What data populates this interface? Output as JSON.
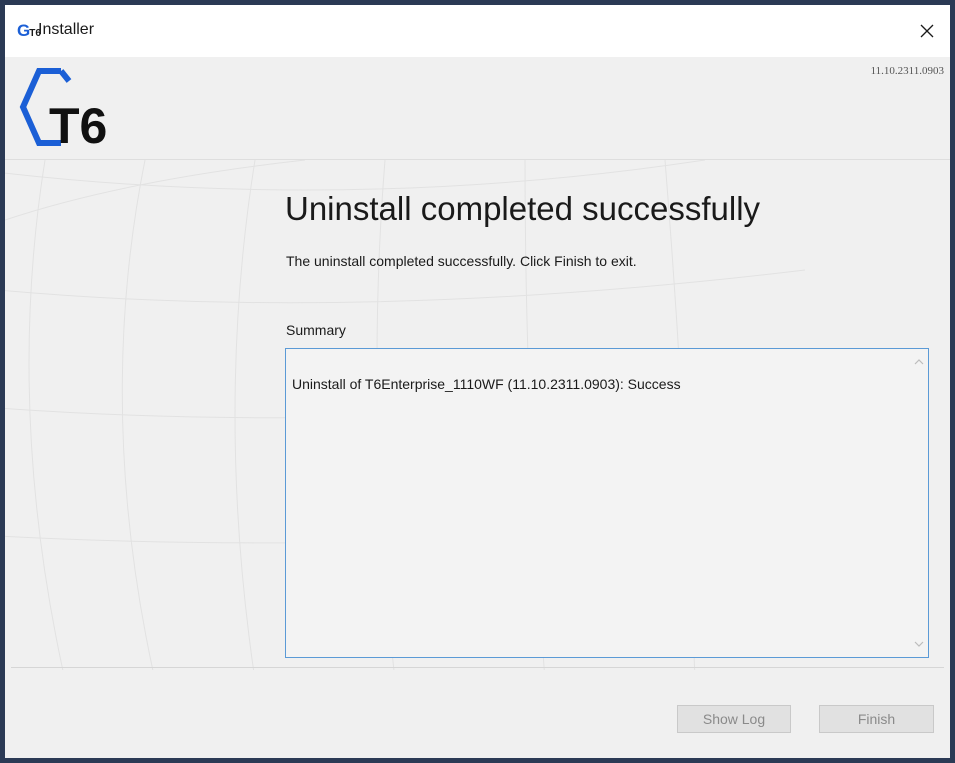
{
  "window": {
    "title": "Installer",
    "icon_letter": "G",
    "icon_sub": "T6"
  },
  "header": {
    "logo_text": "T6",
    "version": "11.10.2311.0903"
  },
  "main": {
    "title": "Uninstall completed successfully",
    "description": "The uninstall completed successfully. Click Finish to exit.",
    "summary_label": "Summary",
    "summary_text": "Uninstall of T6Enterprise_1110WF (11.10.2311.0903): Success"
  },
  "buttons": {
    "show_log": "Show Log",
    "finish": "Finish"
  },
  "colors": {
    "accent": "#1b5fd6",
    "border_focus": "#5b9ad6"
  },
  "icons": {
    "close": "close-icon",
    "scroll_up": "chevron-up-icon",
    "scroll_down": "chevron-down-icon"
  }
}
